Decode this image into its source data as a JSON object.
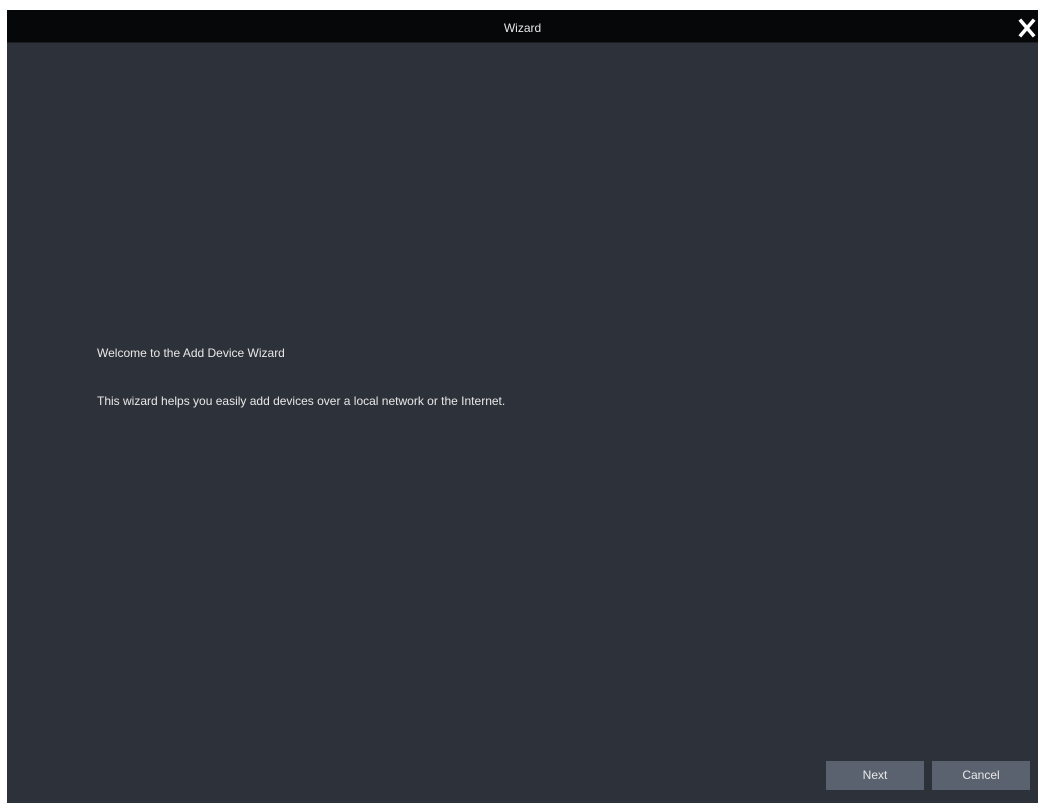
{
  "window": {
    "title": "Wizard",
    "close_icon": "close-icon"
  },
  "content": {
    "welcome_text": "Welcome to the Add Device Wizard",
    "description_text": "This wizard helps you easily add devices over a local network or the Internet."
  },
  "buttons": {
    "next_label": "Next",
    "cancel_label": "Cancel"
  },
  "colors": {
    "background": "#2d3139",
    "titlebar": "#060708",
    "button": "#5a626f",
    "text": "#e8e8e8"
  }
}
